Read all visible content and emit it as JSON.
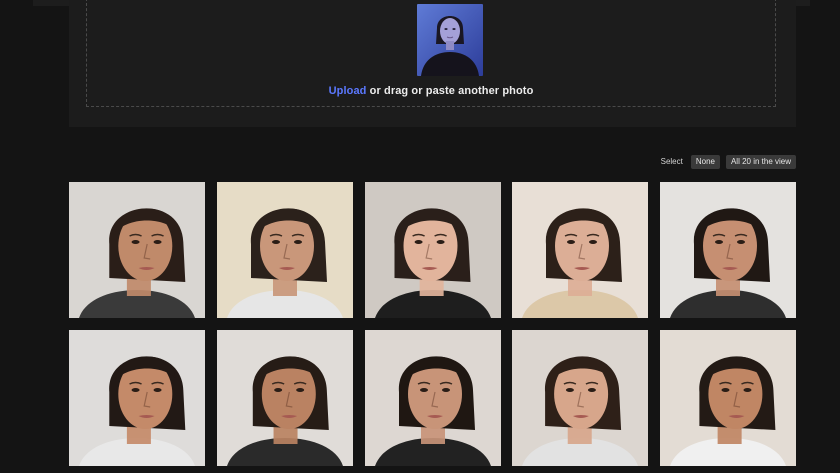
{
  "upload": {
    "link_label": "Upload",
    "rest_text": " or drag or paste another photo"
  },
  "select": {
    "label": "Select",
    "none_label": "None",
    "all_label": "All 20 in the view"
  },
  "colors": {
    "accent": "#5b78ff",
    "background": "#141414",
    "panel": "#1c1c1c"
  },
  "faces": [
    {
      "bg": "#d9d6d2",
      "skin": "#c08a6a",
      "hair": "#2a1e18",
      "turn": 0.35,
      "shirt": "#3a3a3a"
    },
    {
      "bg": "#e6dcc6",
      "skin": "#c9977a",
      "hair": "#2b211b",
      "turn": 0.0,
      "shirt": "#e6e6e6"
    },
    {
      "bg": "#cfc9c3",
      "skin": "#e2b49c",
      "hair": "#2a1f1a",
      "turn": -0.25,
      "shirt": "#1e1e1e"
    },
    {
      "bg": "#e8dfd6",
      "skin": "#dcae96",
      "hair": "#2c2019",
      "turn": 0.0,
      "shirt": "#dcc8a8"
    },
    {
      "bg": "#e4e2df",
      "skin": "#c68f72",
      "hair": "#201814",
      "turn": 0.0,
      "shirt": "#2e2e2e"
    },
    {
      "bg": "#dedcda",
      "skin": "#c48a69",
      "hair": "#221915",
      "turn": 0.35,
      "shirt": "#e8e8e8"
    },
    {
      "bg": "#e0dcd8",
      "skin": "#ba8262",
      "hair": "#261c16",
      "turn": 0.1,
      "shirt": "#2a2a2a"
    },
    {
      "bg": "#ddd7d2",
      "skin": "#c89478",
      "hair": "#1f1712",
      "turn": 0.0,
      "shirt": "#222222"
    },
    {
      "bg": "#dcd6d0",
      "skin": "#d7a68b",
      "hair": "#2e2018",
      "turn": -0.05,
      "shirt": "#e2e2e2"
    },
    {
      "bg": "#e3dcd4",
      "skin": "#c08664",
      "hair": "#231a15",
      "turn": 0.3,
      "shirt": "#f0f0f0"
    }
  ]
}
